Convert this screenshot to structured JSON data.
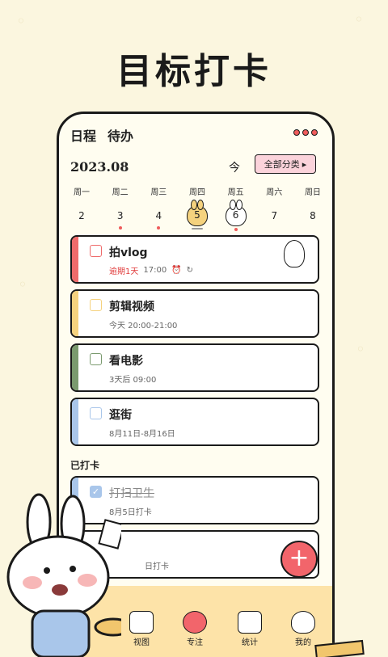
{
  "headline": "目标打卡",
  "tabs": [
    "日程",
    "待办"
  ],
  "year_month": "2023.08",
  "today_label": "今",
  "filter_label": "全部分类",
  "week": [
    {
      "weekday": "周一",
      "date": "2",
      "dot": false
    },
    {
      "weekday": "周二",
      "date": "3",
      "dot": true
    },
    {
      "weekday": "周三",
      "date": "4",
      "dot": true
    },
    {
      "weekday": "周四",
      "date": "5",
      "dot": false,
      "style": "selected"
    },
    {
      "weekday": "周五",
      "date": "6",
      "dot": true,
      "style": "bunny"
    },
    {
      "weekday": "周六",
      "date": "7",
      "dot": false
    },
    {
      "weekday": "周日",
      "date": "8",
      "dot": false
    }
  ],
  "tasks": [
    {
      "title": "拍vlog",
      "overdue": "逾期1天",
      "time": "17:00",
      "color": "#ef6b6b"
    },
    {
      "title": "剪辑视频",
      "subtitle": "今天 20:00-21:00",
      "color": "#f5d27e"
    },
    {
      "title": "看电影",
      "subtitle": "3天后 09:00",
      "color": "#7a9a6e"
    },
    {
      "title": "逛街",
      "subtitle": "8月11日-8月16日",
      "color": "#a9c6ea"
    }
  ],
  "done_section": "已打卡",
  "done_tasks": [
    {
      "title": "打扫卫生",
      "subtitle": "8月5日打卡"
    },
    {
      "title": "",
      "subtitle": "日打卡"
    }
  ],
  "nav": [
    "视图",
    "专注",
    "统计",
    "我的"
  ],
  "fab": "+",
  "check_mark": "✓"
}
